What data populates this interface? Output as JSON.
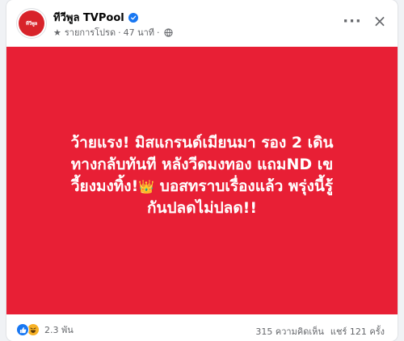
{
  "post": {
    "page_name": "ทีวีพูล TVPool",
    "avatar_text": "ทีวีพูล",
    "meta": {
      "program": "รายการโปรด",
      "time_ago": "47 นาที"
    },
    "more_label": "···",
    "close_label": "×"
  },
  "banner": {
    "background": "#e81f35",
    "lines": [
      "ว้ายแรง! มิสแกรนด์เมียนมา รอง 2 เดิน",
      "ทางกลับทันที หลังวีดมงทอง แถมND เข",
      "วี้ยงมงทิ้ง!",
      "บอสทราบเรื่องแล้ว พรุ่งนี้รู้",
      "กันปลดไม่ปลด!!"
    ],
    "emoji": "👑"
  },
  "footer": {
    "reaction_count": "2.3 พัน",
    "comments": "315 ความคิดเห็น",
    "shares": "แชร์ 121 ครั้ง"
  },
  "colors": {
    "brand_red": "#e81f35",
    "verified_blue": "#1877f2",
    "secondary_text": "#65676b"
  }
}
